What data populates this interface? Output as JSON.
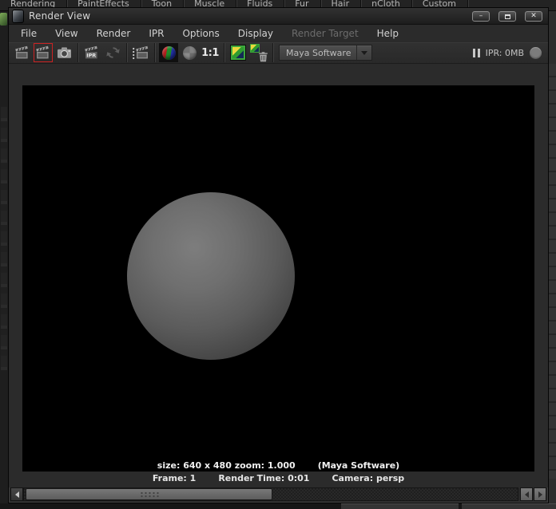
{
  "background": {
    "shelf_tabs": [
      "Rendering",
      "PaintEffects",
      "Toon",
      "Muscle",
      "Fluids",
      "Fur",
      "Hair",
      "nCloth",
      "Custom"
    ]
  },
  "window": {
    "title": "Render View",
    "controls": {
      "minimize_glyph": "–",
      "close_glyph": "✕"
    }
  },
  "menu": {
    "items": [
      {
        "label": "File"
      },
      {
        "label": "View"
      },
      {
        "label": "Render"
      },
      {
        "label": "IPR"
      },
      {
        "label": "Options"
      },
      {
        "label": "Display"
      },
      {
        "label": "Render Target",
        "disabled": true
      },
      {
        "label": "Help"
      }
    ]
  },
  "toolbar": {
    "icons": [
      "redo-previous-render",
      "render-current-frame",
      "snapshot-camera",
      "ipr-render",
      "redo-previous-ipr",
      "render-region",
      "rgb-channels",
      "alpha-channel",
      "real-size",
      "keep-image",
      "remove-image"
    ],
    "ipr_clapper_text": "IPR",
    "real_size_label": "1:1",
    "renderer_dropdown_value": "Maya Software",
    "ipr_memory_label": "IPR: 0MB"
  },
  "image_area": {
    "status_size_zoom": "size: 640 x 480 zoom: 1.000",
    "status_renderer": "(Maya Software)"
  },
  "status_bar": {
    "frame": "Frame: 1",
    "render_time": "Render Time: 0:01",
    "camera": "Camera: persp"
  },
  "colors": {
    "selected_outline": "#cc2222",
    "keep_image_green": "#3da63d",
    "window_bg": "#2b2b2b",
    "image_bg": "#000000"
  }
}
